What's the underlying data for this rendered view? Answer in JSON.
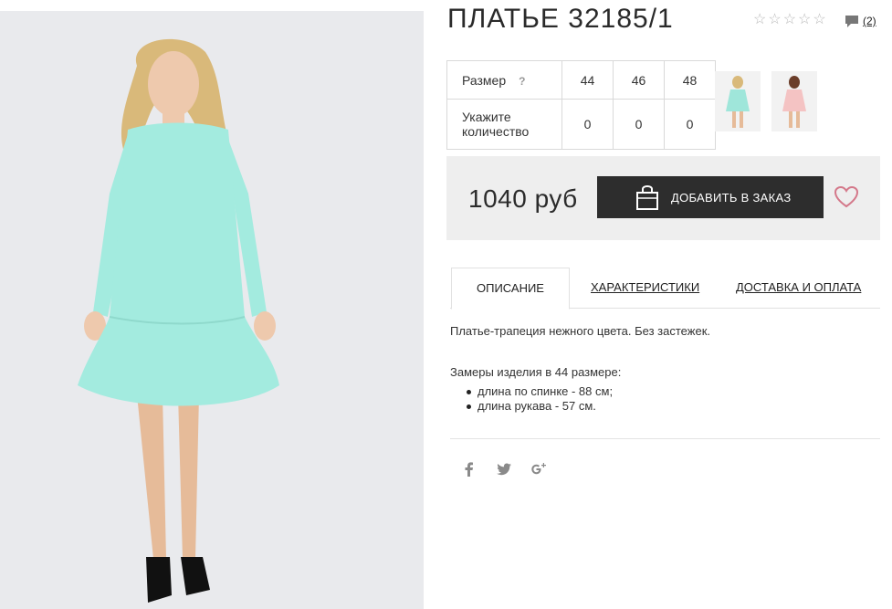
{
  "product": {
    "title": "ПЛАТЬЕ 32185/1",
    "rating_stars": 5,
    "comments_count": "(2)"
  },
  "sizes": {
    "size_label": "Размер",
    "help_mark": "?",
    "size_values": [
      "44",
      "46",
      "48"
    ],
    "qty_label": "Укажите количество",
    "qty_values": [
      "0",
      "0",
      "0"
    ]
  },
  "thumbnails": [
    {
      "color": "#9fe6da",
      "name": "thumbnail-mint-dress"
    },
    {
      "color": "#f4c3c3",
      "name": "thumbnail-pink-dress"
    }
  ],
  "purchase": {
    "price": "1040 руб",
    "add_button_label": "ДОБАВИТЬ В ЗАКАЗ"
  },
  "tabs": [
    {
      "label": "ОПИСАНИЕ",
      "active": true
    },
    {
      "label": "ХАРАКТЕРИСТИКИ",
      "active": false
    },
    {
      "label": "ДОСТАВКА И ОПЛАТА",
      "active": false
    }
  ],
  "description": {
    "text": "Платье-трапеция нежного цвета. Без застежек.",
    "measurements_title": "Замеры изделия в 44 размере:",
    "measurements": [
      "длина по спинке - 88 см;",
      "длина рукава - 57 см."
    ]
  },
  "social": [
    "facebook-icon",
    "twitter-icon",
    "google-plus-icon"
  ],
  "colors": {
    "dress": "#a3ebdf",
    "button_bg": "#2d2d2d",
    "heart": "#d4788a",
    "buybox_bg": "#eeeeee"
  }
}
